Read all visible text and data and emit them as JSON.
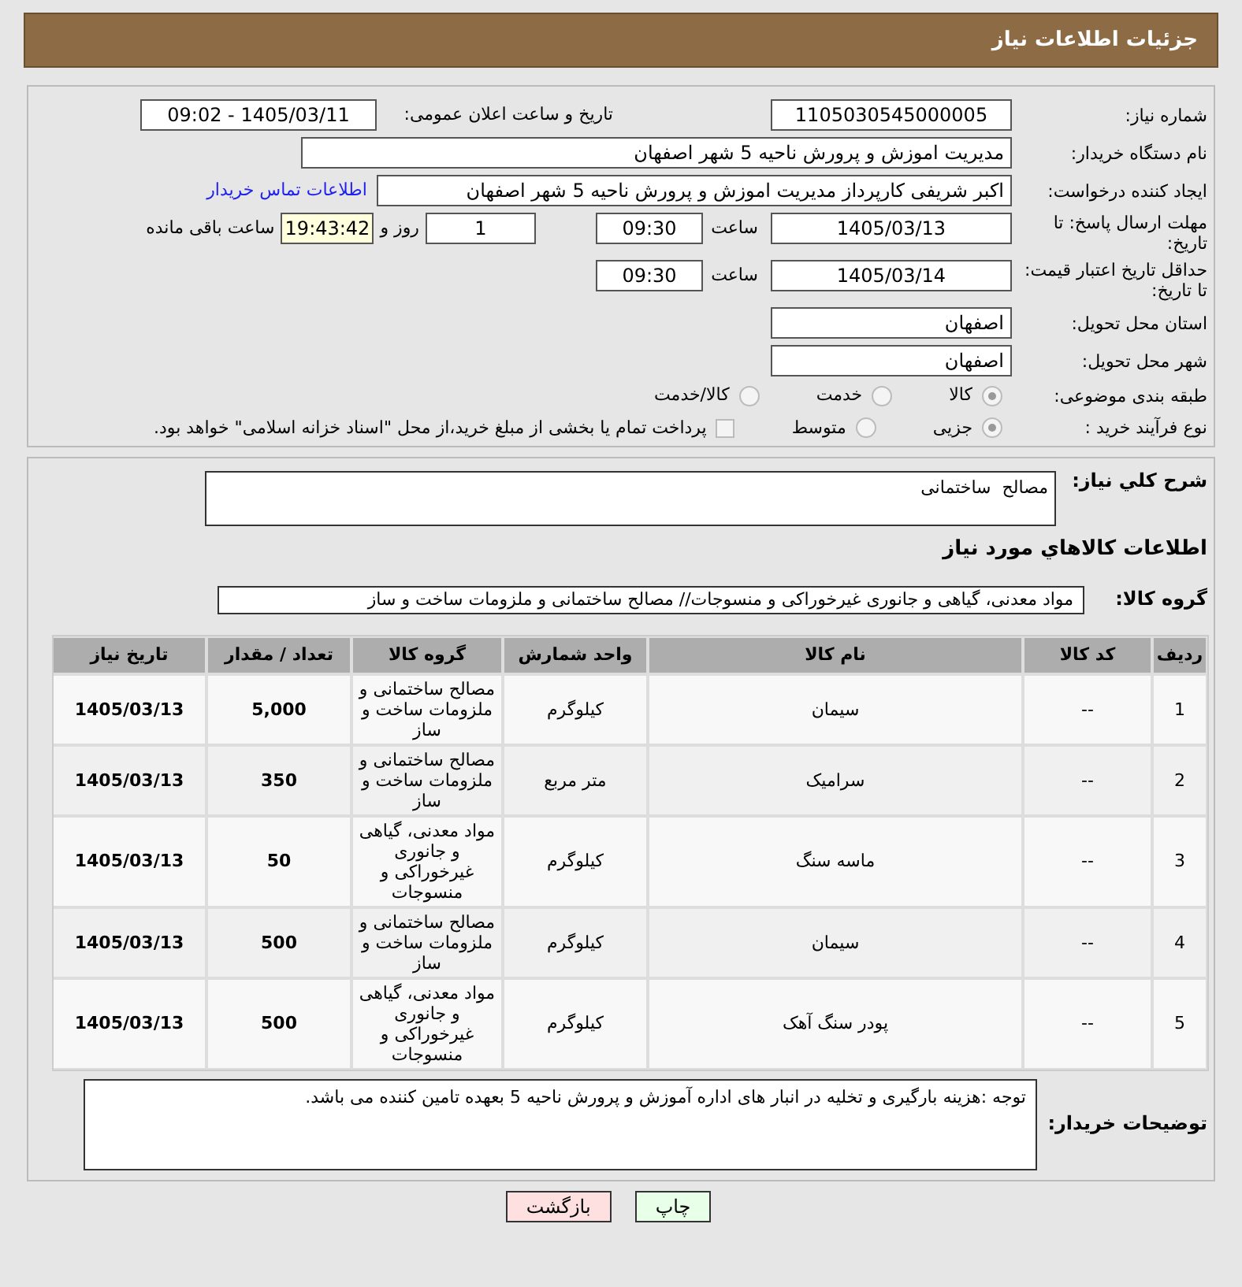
{
  "header": {
    "title": "جزئیات اطلاعات نیاز"
  },
  "need_number": {
    "label": "شماره نیاز:",
    "value": "1105030545000005"
  },
  "announce": {
    "label": "تاریخ و ساعت اعلان عمومی:",
    "value": "1405/03/11 - 09:02"
  },
  "buyer_org": {
    "label": "نام دستگاه خریدار:",
    "value": "مدیریت اموزش و پرورش ناحیه 5 شهر اصفهان"
  },
  "requester": {
    "label": "ایجاد کننده درخواست:",
    "value": "اکبر شریفی کارپرداز مدیریت اموزش و پرورش ناحیه 5 شهر اصفهان",
    "link": "اطلاعات تماس خریدار"
  },
  "deadline": {
    "label": "مهلت ارسال پاسخ: تا تاریخ:",
    "date": "1405/03/13",
    "time_label": "ساعت",
    "time": "09:30",
    "days": "1",
    "days_label": "روز و",
    "remaining": "19:43:42",
    "remaining_label": "ساعت باقی مانده"
  },
  "validity": {
    "label": "حداقل تاریخ اعتبار قیمت: تا تاریخ:",
    "date": "1405/03/14",
    "time_label": "ساعت",
    "time": "09:30"
  },
  "province": {
    "label": "استان محل تحویل:",
    "value": "اصفهان"
  },
  "city": {
    "label": "شهر محل تحویل:",
    "value": "اصفهان"
  },
  "category": {
    "label": "طبقه بندی موضوعی:",
    "options": [
      {
        "label": "کالا",
        "selected": true
      },
      {
        "label": "خدمت",
        "selected": false
      },
      {
        "label": "کالا/خدمت",
        "selected": false
      }
    ]
  },
  "purchase_type": {
    "label": "نوع فرآیند خرید :",
    "options": [
      {
        "label": "جزیی",
        "selected": true
      },
      {
        "label": "متوسط",
        "selected": false
      }
    ],
    "treasury": {
      "label": "پرداخت تمام یا بخشی از مبلغ خرید،از محل \"اسناد خزانه اسلامی\" خواهد بود.",
      "checked": false
    }
  },
  "description": {
    "label": "شرح کلي نياز:",
    "value": "مصالح  ساختمانی"
  },
  "goods_title": "اطلاعات کالاهاي مورد نياز",
  "goods_group": {
    "label": "گروه کالا:",
    "value": "مواد معدنی، گیاهی و جانوری غیرخوراکی و منسوجات// مصالح ساختمانی و ملزومات ساخت و ساز"
  },
  "table": {
    "columns": [
      "ردیف",
      "کد کالا",
      "نام کالا",
      "واحد شمارش",
      "گروه کالا",
      "تعداد / مقدار",
      "تاریخ نیاز"
    ],
    "rows": [
      [
        "1",
        "--",
        "سیمان",
        "کیلوگرم",
        "مصالح ساختمانی و ملزومات ساخت و ساز",
        "5,000",
        "1405/03/13"
      ],
      [
        "2",
        "--",
        "سرامیک",
        "متر مربع",
        "مصالح ساختمانی و ملزومات ساخت و ساز",
        "350",
        "1405/03/13"
      ],
      [
        "3",
        "--",
        "ماسه سنگ",
        "کیلوگرم",
        "مواد معدنی، گیاهی و جانوری غیرخوراکی و منسوجات",
        "50",
        "1405/03/13"
      ],
      [
        "4",
        "--",
        "سیمان",
        "کیلوگرم",
        "مصالح ساختمانی و ملزومات ساخت و ساز",
        "500",
        "1405/03/13"
      ],
      [
        "5",
        "--",
        "پودر سنگ آهک",
        "کیلوگرم",
        "مواد معدنی، گیاهی و جانوری غیرخوراکی و منسوجات",
        "500",
        "1405/03/13"
      ]
    ]
  },
  "buyer_notes": {
    "label": "توضیحات خریدار:",
    "value": "توجه :هزینه بارگیری و تخلیه در انبار های اداره آموزش و پرورش ناحیه 5 بعهده تامین کننده می باشد."
  },
  "buttons": [
    {
      "label": "چاپ",
      "kind": "print"
    },
    {
      "label": "بازگشت",
      "kind": "back"
    }
  ]
}
